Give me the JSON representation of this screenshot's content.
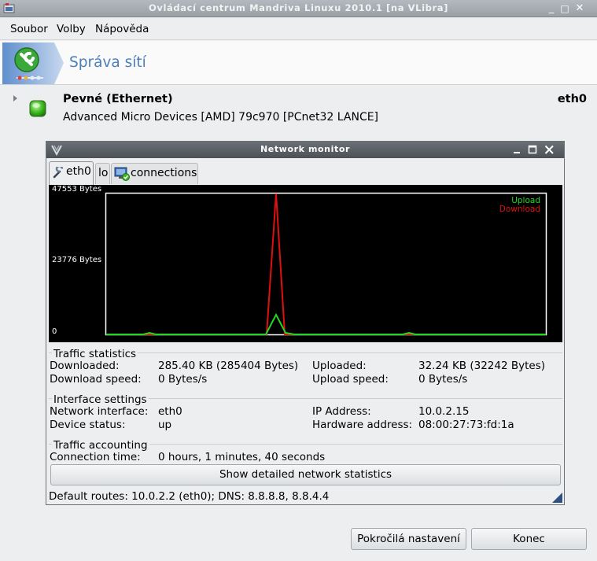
{
  "window": {
    "title": "Ovládací centrum Mandriva Linuxu 2010.1 [na VLibra]",
    "controls": [
      "_",
      "□",
      "✕"
    ]
  },
  "menu": {
    "file": "Soubor",
    "options": "Volby",
    "help": "Nápověda"
  },
  "banner": {
    "title": "Správa sítí",
    "icon": "network-tools-icon"
  },
  "device": {
    "name": "Pevné (Ethernet)",
    "description": "Advanced Micro Devices [AMD] 79c970 [PCnet32 LANCE]",
    "interface": "eth0",
    "status_color": "#3cb81e"
  },
  "monitor": {
    "title": "Network monitor",
    "tabs": [
      {
        "label": "eth0",
        "icon": "wrench-icon",
        "active": true
      },
      {
        "label": "lo",
        "active": false
      },
      {
        "label": "connections",
        "icon": "network-connected-icon",
        "active": false
      }
    ],
    "graph": {
      "max_label": "47553 Bytes",
      "mid_label": "23776 Bytes",
      "zero_label": "0",
      "legend_upload": "Upload",
      "legend_download": "Download",
      "upload_color": "#22d822",
      "download_color": "#e01010"
    },
    "traffic": {
      "heading": "Traffic statistics",
      "downloaded_label": "Downloaded:",
      "downloaded_value": "285.40 KB (285404 Bytes)",
      "uploaded_label": "Uploaded:",
      "uploaded_value": "32.24 KB (32242 Bytes)",
      "download_speed_label": "Download speed:",
      "download_speed_value": "0 Bytes/s",
      "upload_speed_label": "Upload speed:",
      "upload_speed_value": "0 Bytes/s"
    },
    "interface": {
      "heading": "Interface settings",
      "network_interface_label": "Network interface:",
      "network_interface_value": "eth0",
      "ip_label": "IP Address:",
      "ip_value": "10.0.2.15",
      "status_label": "Device status:",
      "status_value": "up",
      "hw_label": "Hardware address:",
      "hw_value": "08:00:27:73:fd:1a"
    },
    "accounting": {
      "heading": "Traffic accounting",
      "connection_time_label": "Connection time:",
      "connection_time_value": "0 hours, 1 minutes, 40 seconds",
      "details_button": "Show detailed network statistics"
    },
    "status": "Default routes: 10.0.2.2 (eth0); DNS: 8.8.8.8, 8.8.4.4"
  },
  "buttons": {
    "advanced": "Pokročilá nastavení",
    "quit": "Konec"
  }
}
